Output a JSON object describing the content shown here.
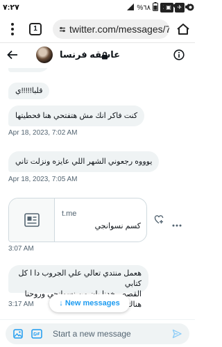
{
  "status_bar": {
    "time": "٧:٢٧",
    "battery": "%٦٨",
    "sim_label": "2"
  },
  "browser": {
    "tab_count": "1",
    "url": "twitter.com/messages/7"
  },
  "chat_header": {
    "name": "عاشقه فرنسا"
  },
  "messages": [
    {
      "text": "قلبا!!!!!ي"
    },
    {
      "text": "كنت فاكر انك مش هتفتحي هنا فحطيتها",
      "timestamp": "Apr 18, 2023, 7:02 AM"
    },
    {
      "text": "يوووه رجعوني الشهر اللي عايزه ونزلت تاني",
      "timestamp": "Apr 18, 2023, 7:05 AM"
    }
  ],
  "link_card": {
    "domain": "t.me",
    "title": "كسم نسوانجي",
    "timestamp": "3:07 AM"
  },
  "last_message": {
    "line1": "هعمل منتدي تعالي علي الجروب دا ا كل كتابي",
    "line2": "القصص خدنا بان من نسوانجي وروحنا هناك",
    "timestamp": "3:17 AM"
  },
  "new_messages_button": "↓ New messages",
  "composer": {
    "placeholder": "Start a new message"
  },
  "colors": {
    "accent": "#1d9bf0",
    "bubble": "#eff3f4",
    "muted": "#536471"
  }
}
